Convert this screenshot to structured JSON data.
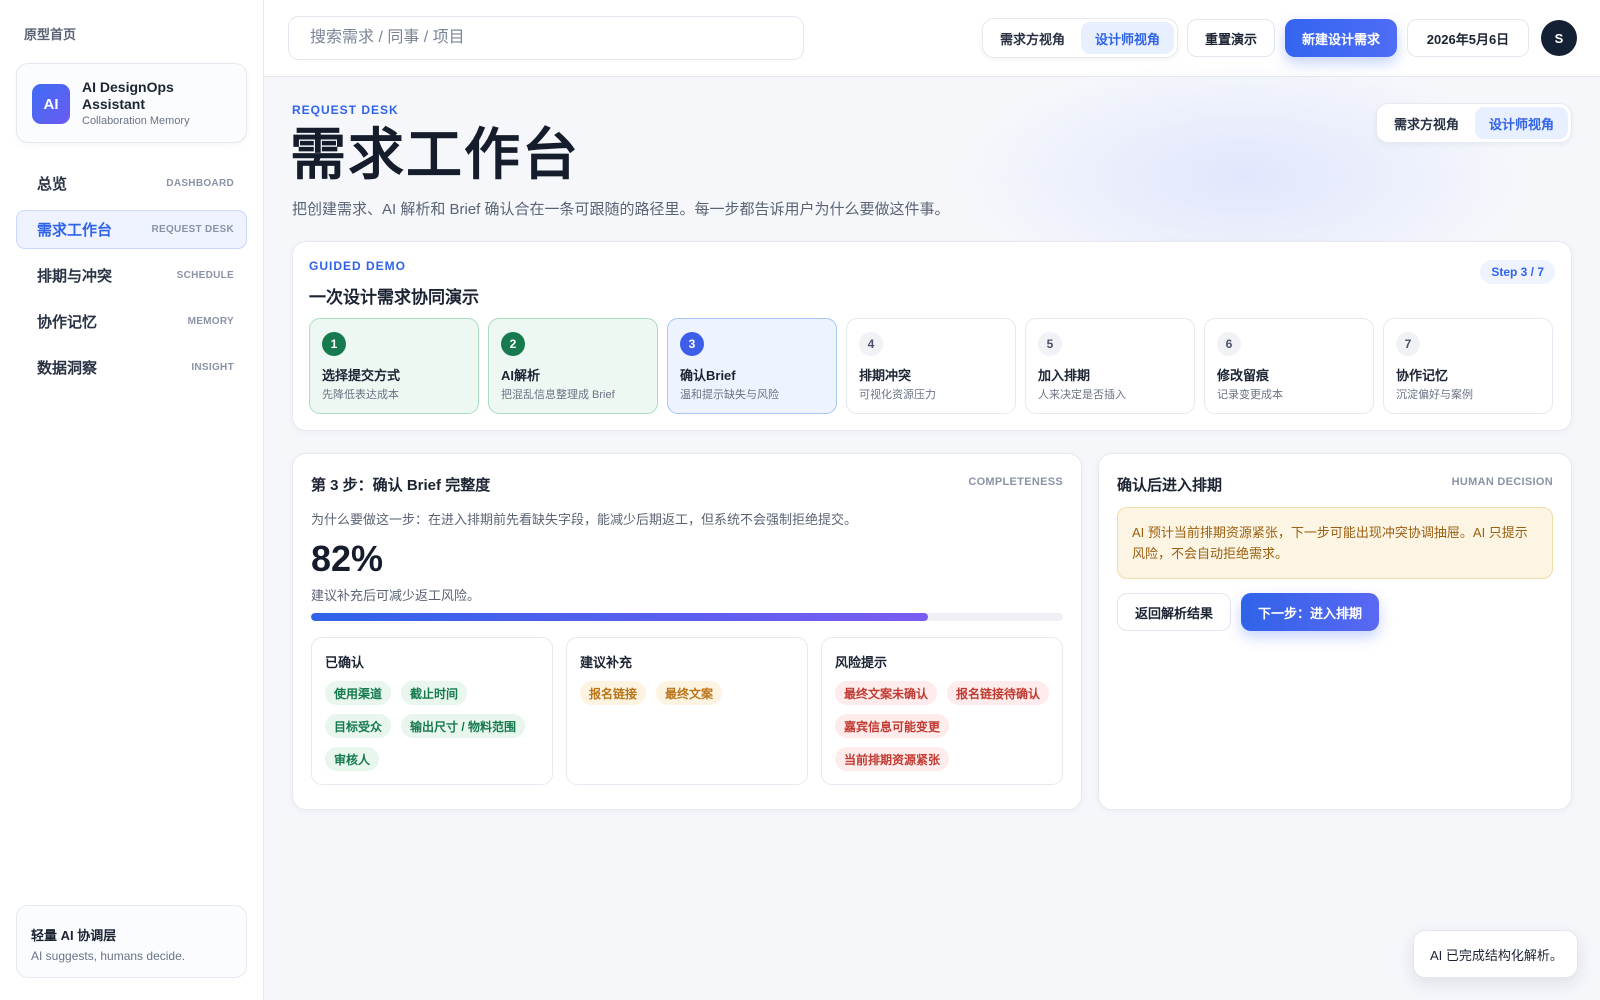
{
  "sidebar": {
    "proto_home": "原型首页",
    "brand": {
      "logo": "AI",
      "name": "AI DesignOps Assistant",
      "subtitle": "Collaboration Memory"
    },
    "items": [
      {
        "label": "总览",
        "sub": "DASHBOARD",
        "active": false
      },
      {
        "label": "需求工作台",
        "sub": "REQUEST DESK",
        "active": true
      },
      {
        "label": "排期与冲突",
        "sub": "SCHEDULE",
        "active": false
      },
      {
        "label": "协作记忆",
        "sub": "MEMORY",
        "active": false
      },
      {
        "label": "数据洞察",
        "sub": "INSIGHT",
        "active": false
      }
    ],
    "footer": {
      "title": "轻量 AI 协调层",
      "subtitle": "AI suggests, humans decide."
    }
  },
  "topbar": {
    "search_placeholder": "搜索需求 / 同事 / 项目",
    "view_toggle": {
      "requester": "需求方视角",
      "designer": "设计师视角",
      "selected": "designer"
    },
    "reset_label": "重置演示",
    "new_label": "新建设计需求",
    "date": "2026年5月6日",
    "avatar": "S"
  },
  "hero": {
    "eyebrow": "REQUEST DESK",
    "title": "需求工作台",
    "description": "把创建需求、AI 解析和 Brief 确认合在一条可跟随的路径里。每一步都告诉用户为什么要做这件事。",
    "view_toggle": {
      "requester": "需求方视角",
      "designer": "设计师视角",
      "selected": "designer"
    }
  },
  "guide": {
    "eyebrow": "GUIDED DEMO",
    "title": "一次设计需求协同演示",
    "step_badge": "Step 3 / 7",
    "steps": [
      {
        "num": "1",
        "title": "选择提交方式",
        "desc": "先降低表达成本",
        "state": "done"
      },
      {
        "num": "2",
        "title": "AI解析",
        "desc": "把混乱信息整理成 Brief",
        "state": "done"
      },
      {
        "num": "3",
        "title": "确认Brief",
        "desc": "温和提示缺失与风险",
        "state": "current"
      },
      {
        "num": "4",
        "title": "排期冲突",
        "desc": "可视化资源压力",
        "state": "todo"
      },
      {
        "num": "5",
        "title": "加入排期",
        "desc": "人来决定是否插入",
        "state": "todo"
      },
      {
        "num": "6",
        "title": "修改留痕",
        "desc": "记录变更成本",
        "state": "todo"
      },
      {
        "num": "7",
        "title": "协作记忆",
        "desc": "沉淀偏好与案例",
        "state": "todo"
      }
    ]
  },
  "brief": {
    "title": "第 3 步：确认 Brief 完整度",
    "tag": "COMPLETENESS",
    "why": "为什么要做这一步：在进入排期前先看缺失字段，能减少后期返工，但系统不会强制拒绝提交。",
    "percent_label": "82%",
    "percent_value": 82,
    "hint": "建议补充后可减少返工风险。",
    "columns": [
      {
        "title": "已确认",
        "tone": "green",
        "chips": [
          "使用渠道",
          "截止时间",
          "目标受众",
          "输出尺寸 / 物料范围",
          "审核人"
        ]
      },
      {
        "title": "建议补充",
        "tone": "amber",
        "chips": [
          "报名链接",
          "最终文案"
        ]
      },
      {
        "title": "风险提示",
        "tone": "red",
        "chips": [
          "最终文案未确认",
          "报名链接待确认",
          "嘉宾信息可能变更",
          "当前排期资源紧张"
        ]
      }
    ]
  },
  "decision": {
    "title": "确认后进入排期",
    "tag": "HUMAN DECISION",
    "warning": "AI 预计当前排期资源紧张，下一步可能出现冲突协调抽屉。AI 只提示风险，不会自动拒绝需求。",
    "back_label": "返回解析结果",
    "next_label": "下一步：进入排期"
  },
  "toast": "AI 已完成结构化解析。"
}
